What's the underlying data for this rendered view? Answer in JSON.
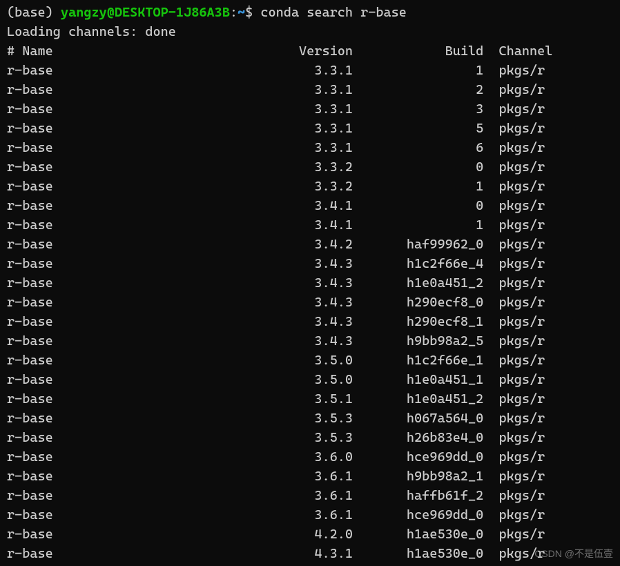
{
  "prompt": {
    "env": "(base) ",
    "userhost": "yangzy@DESKTOP-1J86A3B",
    "colon": ":",
    "path": "~",
    "dollar": "$ ",
    "command": "conda search r-base"
  },
  "loading": "Loading channels: done",
  "header": {
    "name": "# Name",
    "version": "Version",
    "build": "Build",
    "channel": "Channel"
  },
  "rows": [
    {
      "name": "r-base",
      "version": "3.3.1",
      "build": "1",
      "channel": "pkgs/r"
    },
    {
      "name": "r-base",
      "version": "3.3.1",
      "build": "2",
      "channel": "pkgs/r"
    },
    {
      "name": "r-base",
      "version": "3.3.1",
      "build": "3",
      "channel": "pkgs/r"
    },
    {
      "name": "r-base",
      "version": "3.3.1",
      "build": "5",
      "channel": "pkgs/r"
    },
    {
      "name": "r-base",
      "version": "3.3.1",
      "build": "6",
      "channel": "pkgs/r"
    },
    {
      "name": "r-base",
      "version": "3.3.2",
      "build": "0",
      "channel": "pkgs/r"
    },
    {
      "name": "r-base",
      "version": "3.3.2",
      "build": "1",
      "channel": "pkgs/r"
    },
    {
      "name": "r-base",
      "version": "3.4.1",
      "build": "0",
      "channel": "pkgs/r"
    },
    {
      "name": "r-base",
      "version": "3.4.1",
      "build": "1",
      "channel": "pkgs/r"
    },
    {
      "name": "r-base",
      "version": "3.4.2",
      "build": "haf99962_0",
      "channel": "pkgs/r"
    },
    {
      "name": "r-base",
      "version": "3.4.3",
      "build": "h1c2f66e_4",
      "channel": "pkgs/r"
    },
    {
      "name": "r-base",
      "version": "3.4.3",
      "build": "h1e0a451_2",
      "channel": "pkgs/r"
    },
    {
      "name": "r-base",
      "version": "3.4.3",
      "build": "h290ecf8_0",
      "channel": "pkgs/r"
    },
    {
      "name": "r-base",
      "version": "3.4.3",
      "build": "h290ecf8_1",
      "channel": "pkgs/r"
    },
    {
      "name": "r-base",
      "version": "3.4.3",
      "build": "h9bb98a2_5",
      "channel": "pkgs/r"
    },
    {
      "name": "r-base",
      "version": "3.5.0",
      "build": "h1c2f66e_1",
      "channel": "pkgs/r"
    },
    {
      "name": "r-base",
      "version": "3.5.0",
      "build": "h1e0a451_1",
      "channel": "pkgs/r"
    },
    {
      "name": "r-base",
      "version": "3.5.1",
      "build": "h1e0a451_2",
      "channel": "pkgs/r"
    },
    {
      "name": "r-base",
      "version": "3.5.3",
      "build": "h067a564_0",
      "channel": "pkgs/r"
    },
    {
      "name": "r-base",
      "version": "3.5.3",
      "build": "h26b83e4_0",
      "channel": "pkgs/r"
    },
    {
      "name": "r-base",
      "version": "3.6.0",
      "build": "hce969dd_0",
      "channel": "pkgs/r"
    },
    {
      "name": "r-base",
      "version": "3.6.1",
      "build": "h9bb98a2_1",
      "channel": "pkgs/r"
    },
    {
      "name": "r-base",
      "version": "3.6.1",
      "build": "haffb61f_2",
      "channel": "pkgs/r"
    },
    {
      "name": "r-base",
      "version": "3.6.1",
      "build": "hce969dd_0",
      "channel": "pkgs/r"
    },
    {
      "name": "r-base",
      "version": "4.2.0",
      "build": "h1ae530e_0",
      "channel": "pkgs/r"
    },
    {
      "name": "r-base",
      "version": "4.3.1",
      "build": "h1ae530e_0",
      "channel": "pkgs/r"
    }
  ],
  "colwidths": {
    "name": 28,
    "version": 17,
    "build": 17,
    "channel": 9
  },
  "watermark": "CSDN @不是伍壹"
}
